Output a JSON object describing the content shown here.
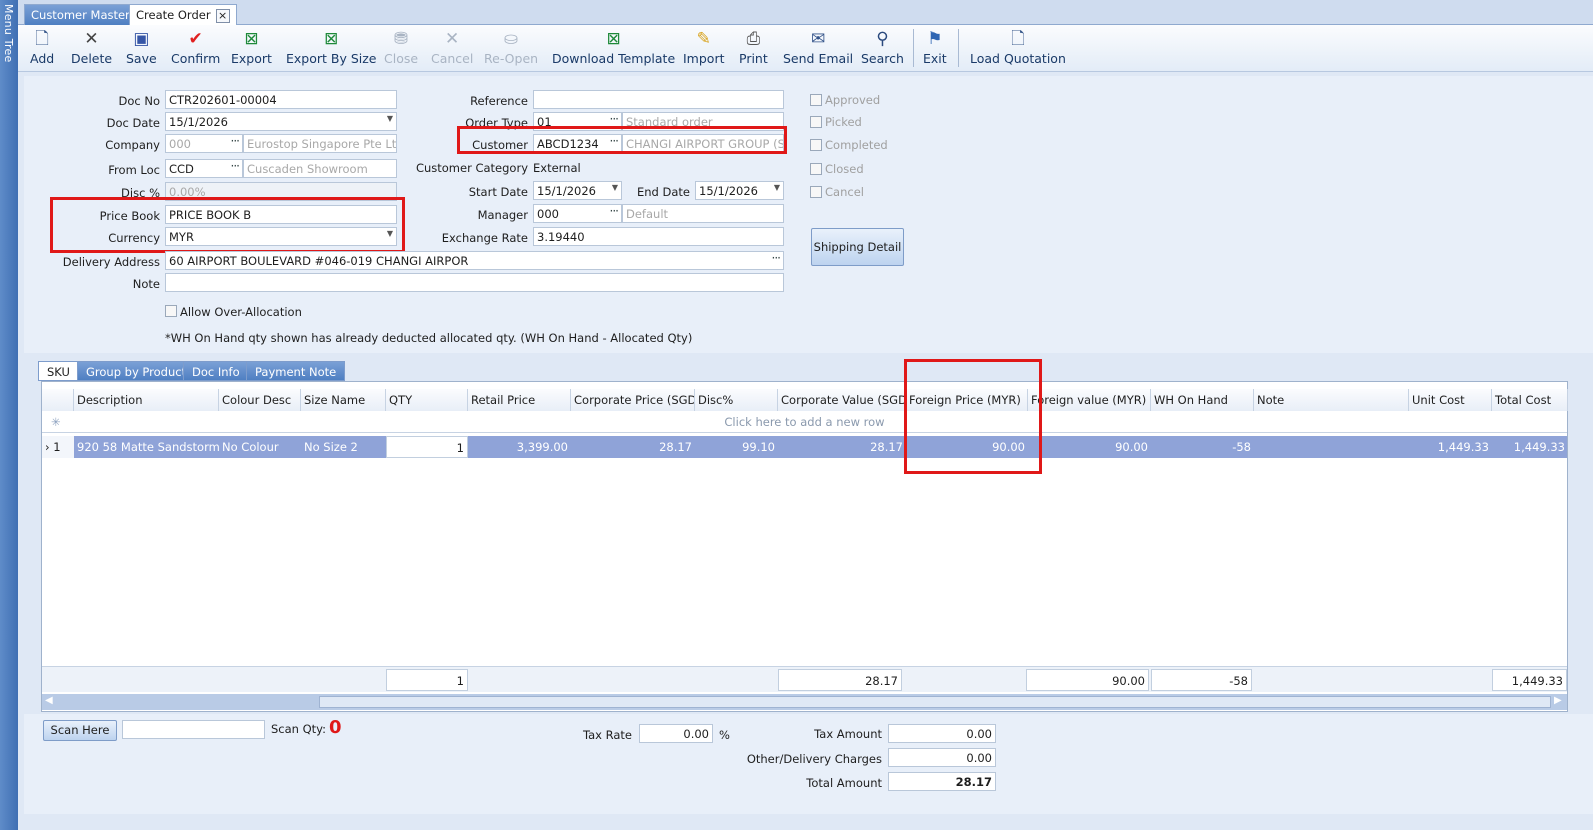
{
  "menu_tree": "Menu Tree",
  "tabs": [
    {
      "label": "Customer Master"
    },
    {
      "label": "Create Order"
    }
  ],
  "tab_close": "×",
  "toolbar": [
    {
      "label": "Add",
      "icon": "add-icon"
    },
    {
      "label": "Delete",
      "icon": "delete-icon"
    },
    {
      "label": "Save",
      "icon": "save-icon"
    },
    {
      "label": "Confirm",
      "icon": "confirm-icon"
    },
    {
      "label": "Export",
      "icon": "excel-icon"
    },
    {
      "label": "Export By Size",
      "icon": "excel-icon"
    },
    {
      "label": "Close",
      "icon": "close-icon",
      "disabled": true
    },
    {
      "label": "Cancel",
      "icon": "cancel-icon",
      "disabled": true
    },
    {
      "label": "Re-Open",
      "icon": "reopen-icon",
      "disabled": true
    },
    {
      "label": "Download Template",
      "icon": "excel-icon"
    },
    {
      "label": "Import",
      "icon": "import-icon"
    },
    {
      "label": "Print",
      "icon": "print-icon"
    },
    {
      "label": "Send Email",
      "icon": "email-icon"
    },
    {
      "label": "Search",
      "icon": "binoculars-icon"
    },
    {
      "label": "Exit",
      "icon": "exit-icon"
    },
    {
      "label": "Load Quotation",
      "icon": "load-icon"
    }
  ],
  "form": {
    "doc_no": {
      "label": "Doc No",
      "value": "CTR202601-00004"
    },
    "doc_date": {
      "label": "Doc Date",
      "value": "15/1/2026"
    },
    "company": {
      "label": "Company",
      "code": "000",
      "name": "Eurostop Singapore Pte Ltd"
    },
    "from_loc": {
      "label": "From Loc",
      "code": "CCD",
      "name": "Cuscaden Showroom"
    },
    "disc": {
      "label": "Disc %",
      "value": "0.00%"
    },
    "price_book": {
      "label": "Price Book",
      "value": "PRICE BOOK B"
    },
    "currency": {
      "label": "Currency",
      "value": "MYR"
    },
    "delivery_address": {
      "label": "Delivery Address",
      "value": "60 AIRPORT BOULEVARD #046-019 CHANGI AIRPOR"
    },
    "note": {
      "label": "Note",
      "value": ""
    },
    "reference": {
      "label": "Reference",
      "value": ""
    },
    "order_type": {
      "label": "Order Type",
      "code": "01",
      "name": "Standard order"
    },
    "customer": {
      "label": "Customer",
      "code": "ABCD1234",
      "name": "CHANGI AIRPORT GROUP (S..."
    },
    "customer_category": {
      "label": "Customer Category",
      "value": "External"
    },
    "start_date": {
      "label": "Start Date",
      "value": "15/1/2026"
    },
    "end_date": {
      "label": "End Date",
      "value": "15/1/2026"
    },
    "manager": {
      "label": "Manager",
      "code": "000",
      "name": "Default"
    },
    "exchange_rate": {
      "label": "Exchange Rate",
      "value": "3.19440"
    },
    "status_checks": [
      "Approved",
      "Picked",
      "Completed",
      "Closed",
      "Cancel"
    ],
    "shipping_button": "Shipping Detail",
    "allow_over_allocation": "Allow Over-Allocation",
    "wh_note": "*WH On Hand qty shown has already deducted allocated qty. (WH On Hand - Allocated Qty)"
  },
  "grid_tabs": [
    "SKU",
    "Group by Product",
    "Doc Info",
    "Payment Note"
  ],
  "grid": {
    "columns": [
      "Description",
      "Colour Desc",
      "Size Name",
      "QTY",
      "Retail Price",
      "Corporate Price (SGD)",
      "Disc%",
      "Corporate Value (SGD)",
      "Foreign Price (MYR)",
      "Foreign value (MYR)",
      "WH On Hand",
      "Note",
      "Unit Cost",
      "Total Cost"
    ],
    "new_row_hint": "Click here to add a new row",
    "rows": [
      {
        "index": "1",
        "cells": [
          "920 58 Matte Sandstorm",
          "No Colour",
          "No Size 2",
          "1",
          "3,399.00",
          "28.17",
          "99.10",
          "28.17",
          "90.00",
          "90.00",
          "-58",
          "",
          "1,449.33",
          "1,449.33"
        ]
      }
    ],
    "footer": {
      "qty": "1",
      "corporate_value": "28.17",
      "foreign_value": "90.00",
      "wh_on_hand": "-58",
      "total_cost": "1,449.33"
    }
  },
  "bottom": {
    "scan_button": "Scan Here",
    "scan_qty_label": "Scan Qty:",
    "scan_qty_value": "0",
    "tax_rate_label": "Tax Rate",
    "tax_rate_value": "0.00",
    "percent": "%",
    "tax_amount_label": "Tax Amount",
    "tax_amount_value": "0.00",
    "other_charges_label": "Other/Delivery Charges",
    "other_charges_value": "0.00",
    "total_amount_label": "Total Amount",
    "total_amount_value": "28.17"
  },
  "colors": {
    "highlight_box": "#e01818",
    "selected_row": "#8fa3d8",
    "scan_qty": "#e01818"
  }
}
